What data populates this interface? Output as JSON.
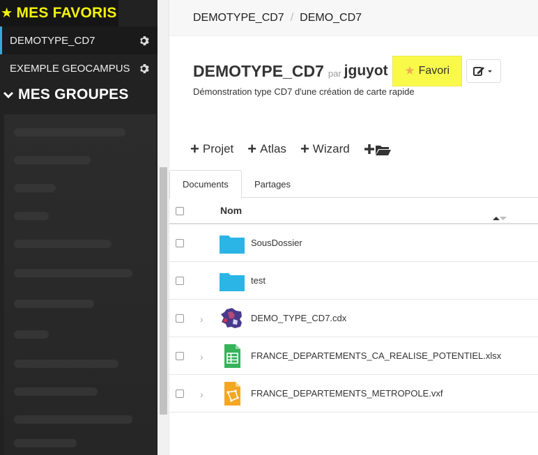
{
  "sidebar": {
    "favorites_title": "MES FAVORIS",
    "favorites": [
      {
        "label": "DEMOTYPE_CD7",
        "active": true
      },
      {
        "label": "EXEMPLE GEOCAMPUS",
        "active": false
      }
    ],
    "groups_title": "MES GROUPES"
  },
  "breadcrumb": [
    "DEMOTYPE_CD7",
    "DEMO_CD7"
  ],
  "header": {
    "title": "DEMOTYPE_CD7",
    "par": "par",
    "author": "jguyot",
    "favori_label": "Favori",
    "subtitle": "Démonstration type CD7 d'une création de carte rapide"
  },
  "toolbar": {
    "projet": "Projet",
    "atlas": "Atlas",
    "wizard": "Wizard"
  },
  "tabs": [
    "Documents",
    "Partages"
  ],
  "table": {
    "header_name": "Nom",
    "rows": [
      {
        "name": "SousDossier",
        "icon": "folder-icon"
      },
      {
        "name": "test",
        "icon": "folder-icon"
      },
      {
        "name": "DEMO_TYPE_CD7.cdx",
        "icon": "map-thumbnail-icon"
      },
      {
        "name": "FRANCE_DEPARTEMENTS_CA_REALISE_POTENTIEL.xlsx",
        "icon": "spreadsheet-icon"
      },
      {
        "name": "FRANCE_DEPARTEMENTS_METROPOLE.vxf",
        "icon": "vector-file-icon"
      }
    ]
  },
  "colors": {
    "highlight": "#f3f20d",
    "sidebar_bg": "#222222",
    "active_border": "#38a7dd",
    "folder": "#2bb5e6",
    "spreadsheet": "#35b45a",
    "vector": "#f5a623"
  }
}
